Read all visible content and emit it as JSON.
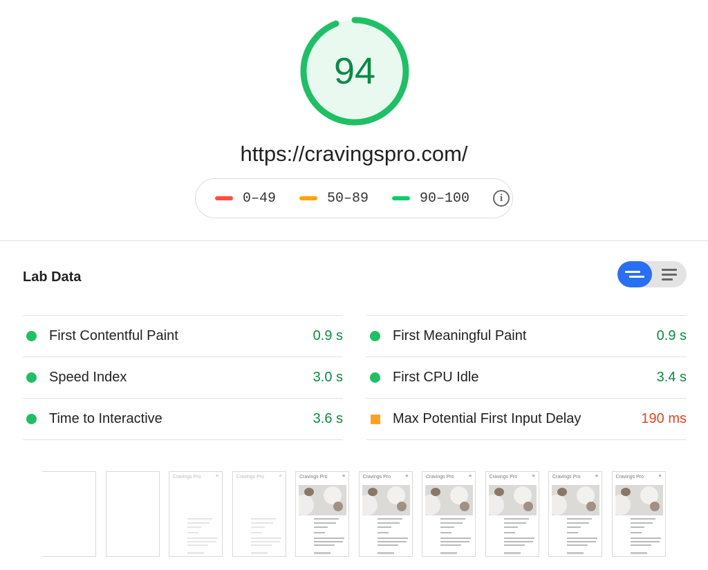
{
  "score": {
    "value": "94",
    "fraction": 0.94,
    "color": "#1fc065"
  },
  "url": "https://cravingspro.com/",
  "legend": {
    "items": [
      {
        "label": "0–49",
        "color": "#ff4e42"
      },
      {
        "label": "50–89",
        "color": "#ffa400"
      },
      {
        "label": "90–100",
        "color": "#0cce6b"
      }
    ],
    "info_icon": "info-icon"
  },
  "lab": {
    "title": "Lab Data",
    "toggle": {
      "active": "summary-view",
      "inactive": "description-view"
    },
    "left": [
      {
        "name": "First Contentful Paint",
        "value": "0.9 s",
        "status": "pass"
      },
      {
        "name": "Speed Index",
        "value": "3.0 s",
        "status": "pass"
      },
      {
        "name": "Time to Interactive",
        "value": "3.6 s",
        "status": "pass"
      }
    ],
    "right": [
      {
        "name": "First Meaningful Paint",
        "value": "0.9 s",
        "status": "pass"
      },
      {
        "name": "First CPU Idle",
        "value": "3.4 s",
        "status": "pass"
      },
      {
        "name": "Max Potential First Input Delay",
        "value": "190 ms",
        "status": "average"
      }
    ]
  },
  "filmstrip": {
    "site_name": "Cravings Pro",
    "frames": [
      {
        "state": "blank"
      },
      {
        "state": "blank"
      },
      {
        "state": "text-only"
      },
      {
        "state": "text-only"
      },
      {
        "state": "full"
      },
      {
        "state": "full"
      },
      {
        "state": "full"
      },
      {
        "state": "full"
      },
      {
        "state": "full"
      },
      {
        "state": "full"
      }
    ]
  }
}
